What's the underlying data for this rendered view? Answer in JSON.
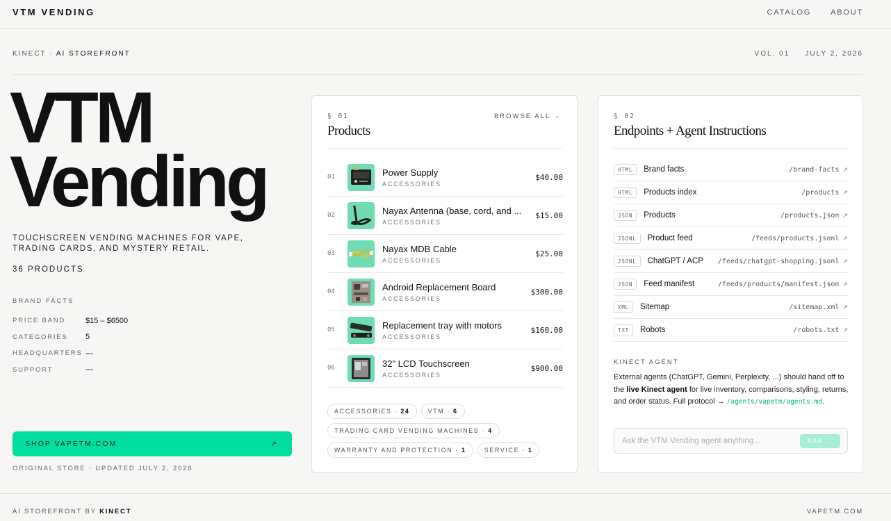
{
  "header": {
    "brand": "VTM VENDING",
    "nav": [
      "CATALOG",
      "ABOUT"
    ]
  },
  "subheader": {
    "left_prefix": "KINECT",
    "left_sep": " · ",
    "left_strong": "AI STOREFRONT",
    "volume": "VOL. 01",
    "date": "JULY 2, 2026"
  },
  "hero": {
    "title_line1": "VTM",
    "title_line2": "Vending",
    "tagline": "TOUCHSCREEN VENDING MACHINES FOR VAPE, TRADING CARDS, AND MYSTERY RETAIL.",
    "product_count": "36 PRODUCTS",
    "facts_label": "BRAND FACTS",
    "facts": [
      {
        "key": "PRICE BAND",
        "value": "$15 – $6500"
      },
      {
        "key": "CATEGORIES",
        "value": "5"
      },
      {
        "key": "HEADQUARTERS",
        "value": "—"
      },
      {
        "key": "SUPPORT",
        "value": "—"
      }
    ],
    "shop_button": "SHOP VAPETM.COM",
    "shop_arrow": "↗",
    "updated": "ORIGINAL STORE · UPDATED JULY 2, 2026"
  },
  "products": {
    "section_num": "§ 01",
    "title": "Products",
    "browse_all": "BROWSE ALL →",
    "items": [
      {
        "index": "01",
        "name": "Power Supply",
        "category": "ACCESSORIES",
        "price": "$40.00"
      },
      {
        "index": "02",
        "name": "Nayax Antenna (base, cord, and ...",
        "category": "ACCESSORIES",
        "price": "$15.00"
      },
      {
        "index": "03",
        "name": "Nayax MDB Cable",
        "category": "ACCESSORIES",
        "price": "$25.00"
      },
      {
        "index": "04",
        "name": "Android Replacement Board",
        "category": "ACCESSORIES",
        "price": "$300.00"
      },
      {
        "index": "05",
        "name": "Replacement tray with motors",
        "category": "ACCESSORIES",
        "price": "$160.00"
      },
      {
        "index": "06",
        "name": "32\" LCD Touchscreen",
        "category": "ACCESSORIES",
        "price": "$900.00"
      }
    ],
    "tags": [
      {
        "label": "ACCESSORIES ·",
        "count": "24"
      },
      {
        "label": "VTM ·",
        "count": "6"
      },
      {
        "label": "TRADING CARD VENDING MACHINES ·",
        "count": "4"
      },
      {
        "label": "WARRANTY AND PROTECTION ·",
        "count": "1"
      },
      {
        "label": "SERVICE ·",
        "count": "1"
      }
    ]
  },
  "endpoints": {
    "section_num": "§ 02",
    "title": "Endpoints + Agent Instructions",
    "arrow": "↗",
    "items": [
      {
        "badge": "HTML",
        "label": "Brand facts",
        "path": "/brand-facts"
      },
      {
        "badge": "HTML",
        "label": "Products index",
        "path": "/products"
      },
      {
        "badge": "JSON",
        "label": "Products",
        "path": "/products.json"
      },
      {
        "badge": "JSONL",
        "label": "Product feed",
        "path": "/feeds/products.jsonl"
      },
      {
        "badge": "JSONL",
        "label": "ChatGPT / ACP",
        "path": "/feeds/chatgpt-shopping.jsonl"
      },
      {
        "badge": "JSON",
        "label": "Feed manifest",
        "path": "/feeds/products/manifest.json"
      },
      {
        "badge": "XML",
        "label": "Sitemap",
        "path": "/sitemap.xml"
      },
      {
        "badge": "TXT",
        "label": "Robots",
        "path": "/robots.txt"
      }
    ],
    "agent_label": "KINECT AGENT",
    "agent_text_1": "External agents (ChatGPT, Gemini, Perplexity, ...) should hand off to the ",
    "agent_text_strong": "live Kinect agent",
    "agent_text_2": " for live inventory, comparisons, styling, returns, and order status. Full protocol → ",
    "agent_link": "/agents/vapetm/agents.md",
    "agent_text_end": ".",
    "ask_placeholder": "Ask the VTM Vending agent anything...",
    "ask_button": "ASK →"
  },
  "footer": {
    "left_prefix": "AI STOREFRONT BY ",
    "left_strong": "KINECT",
    "right": "VAPETM.COM"
  },
  "colors": {
    "accent": "#00dea0",
    "thumb_bg": "#6fdcb1",
    "link": "#00b885"
  }
}
